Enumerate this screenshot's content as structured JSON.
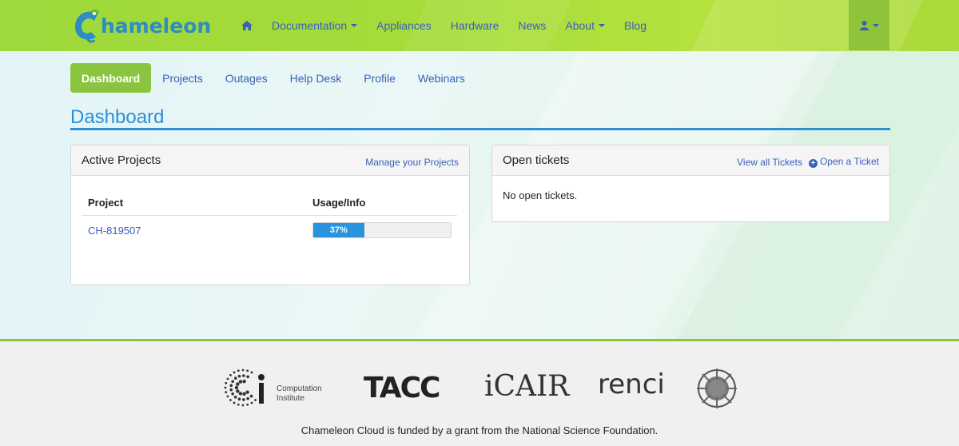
{
  "brand": {
    "name": "hameleon"
  },
  "nav": {
    "items": [
      {
        "label": "Documentation",
        "dropdown": true
      },
      {
        "label": "Appliances",
        "dropdown": false
      },
      {
        "label": "Hardware",
        "dropdown": false
      },
      {
        "label": "News",
        "dropdown": false
      },
      {
        "label": "About",
        "dropdown": true
      },
      {
        "label": "Blog",
        "dropdown": false
      }
    ]
  },
  "subnav": {
    "items": [
      "Dashboard",
      "Projects",
      "Outages",
      "Help Desk",
      "Profile",
      "Webinars"
    ],
    "active": "Dashboard"
  },
  "page": {
    "title": "Dashboard"
  },
  "projects_panel": {
    "title": "Active Projects",
    "manage_link": "Manage your Projects",
    "columns": [
      "Project",
      "Usage/Info"
    ],
    "rows": [
      {
        "project": "CH-819507",
        "usage_label": "37%",
        "usage_fraction": 0.37
      }
    ]
  },
  "tickets_panel": {
    "title": "Open tickets",
    "view_all_link": "View all Tickets",
    "open_link": "Open a Ticket",
    "empty_text": "No open tickets."
  },
  "footer": {
    "logos": {
      "ci_line1": "Computation",
      "ci_line2": "Institute",
      "tacc": "TACC",
      "icair": "iCAIR",
      "renci": "renci"
    },
    "funded_text": "Chameleon Cloud is funded by a grant from the National Science Foundation."
  },
  "colors": {
    "nav_green": "#9ed83a",
    "link_blue": "#3a5fb8",
    "active_green": "#8bc53f",
    "title_blue": "#2f8fd6",
    "progress_blue": "#2a93dd"
  },
  "icons": {
    "home": "home-icon",
    "user": "user-icon",
    "plus_circle": "plus-circle-icon"
  }
}
